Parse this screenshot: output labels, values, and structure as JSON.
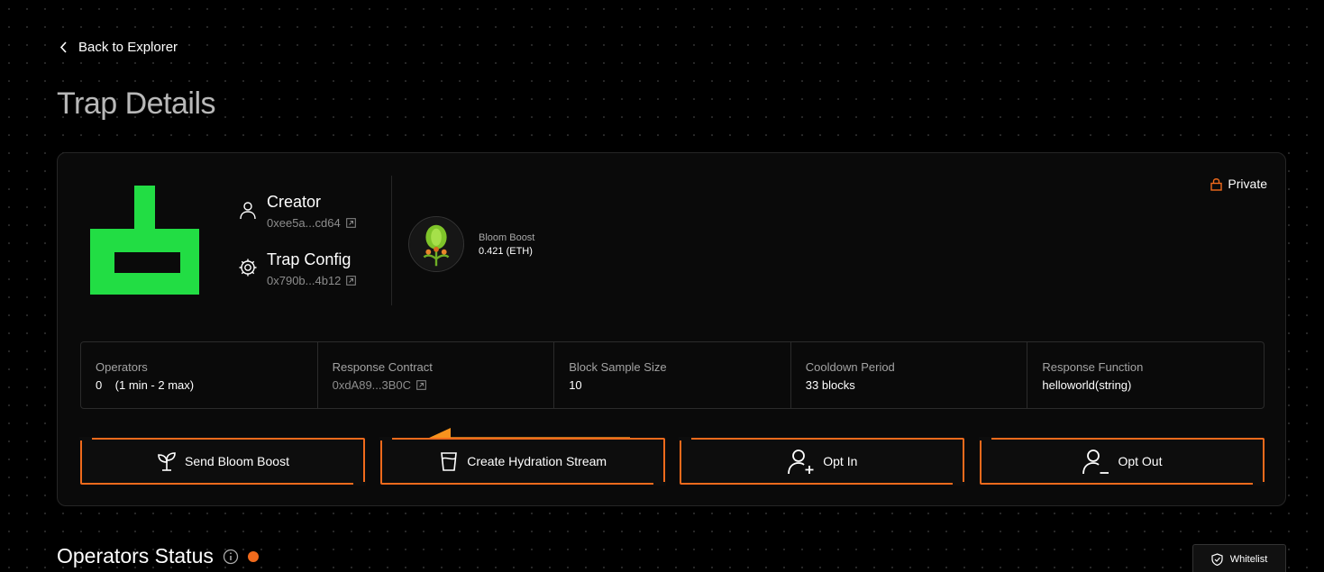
{
  "nav": {
    "back_label": "Back to Explorer"
  },
  "page": {
    "title": "Trap Details"
  },
  "trap": {
    "privacy_label": "Private",
    "creator": {
      "label": "Creator",
      "address": "0xee5a...cd64"
    },
    "config": {
      "label": "Trap Config",
      "address": "0x790b...4b12"
    },
    "boost": {
      "name": "Bloom Boost",
      "value": "0.421 (ETH)"
    }
  },
  "stats": [
    {
      "label": "Operators",
      "value": "0    (1 min - 2 max)"
    },
    {
      "label": "Response Contract",
      "value": "0xdA89...3B0C"
    },
    {
      "label": "Block Sample Size",
      "value": "10"
    },
    {
      "label": "Cooldown Period",
      "value": "33 blocks"
    },
    {
      "label": "Response Function",
      "value": "helloworld(string)"
    }
  ],
  "actions": [
    {
      "label": "Send Bloom Boost",
      "icon": "sprout-icon"
    },
    {
      "label": "Create Hydration Stream",
      "icon": "cup-icon"
    },
    {
      "label": "Opt In",
      "icon": "user-plus-icon"
    },
    {
      "label": "Opt Out",
      "icon": "user-minus-icon"
    }
  ],
  "operators_status": {
    "title": "Operators Status",
    "whitelist_label": "Whitelist"
  },
  "colors": {
    "accent": "#f06a1c",
    "logo_green": "#22dd44",
    "background": "#000000"
  }
}
